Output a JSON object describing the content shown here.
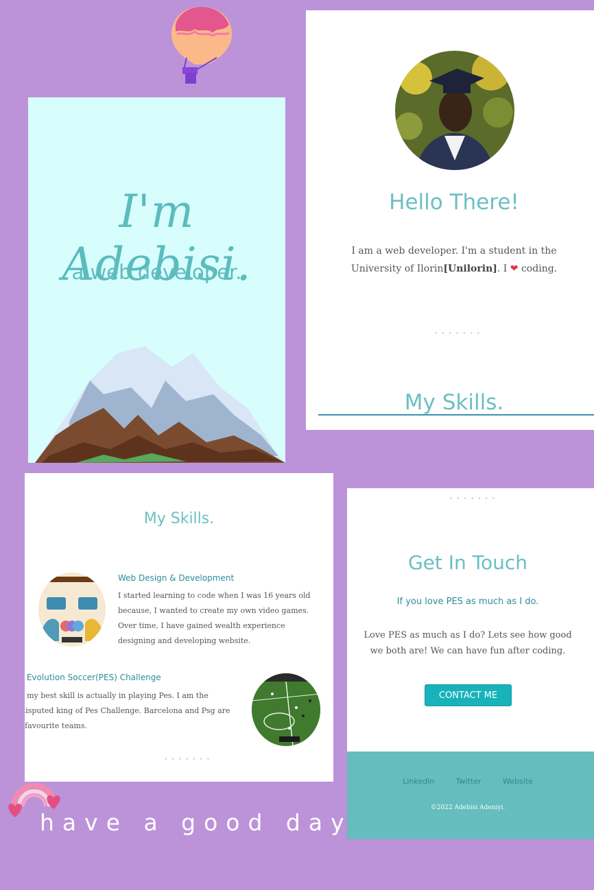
{
  "hero": {
    "name": "I'm Adebisi.",
    "role": "a web developer."
  },
  "about": {
    "title": "Hello There!",
    "text_before": "I am a web developer. I'm a student in the University of Ilorin",
    "text_bold": "[Unilorin]",
    "text_mid": ". I",
    "heart": "❤",
    "text_after": "coding.",
    "skills_heading": "My Skills."
  },
  "skills": {
    "title": "My Skills.",
    "items": [
      {
        "title": "Web Design & Development",
        "text": "I started learning to code when I was 16 years old because, I wanted to create my own video games. Over time, I have gained wealth experience designing and developing website."
      },
      {
        "title": "Pro Evolution Soccer(PES) Challenge",
        "text": "But my best skill is actually in playing Pes. I am the undisputed king of Pes Challenge. Barcelona and Psg are my favourite teams."
      }
    ]
  },
  "contact": {
    "title": "Get In Touch",
    "subtitle": "If you love PES as much as I do.",
    "text": "Love PES as much as I do? Lets see how good we both are! We can have fun after coding.",
    "button": "CONTACT ME",
    "footer_links": [
      "LinkedIn",
      "Twitter",
      "Website"
    ],
    "copyright": "©2022 Adebisi Adeniyi."
  },
  "tagline": "have a good day",
  "dots": "• • • • • • •",
  "icons": [
    "hot-air-balloon-icon",
    "rainbow-hearts-icon",
    "mountain-illustration"
  ],
  "colors": {
    "background": "#bc93d9",
    "accent": "#6bbfc2",
    "button": "#18b2bb",
    "footer": "#66bdbd"
  }
}
